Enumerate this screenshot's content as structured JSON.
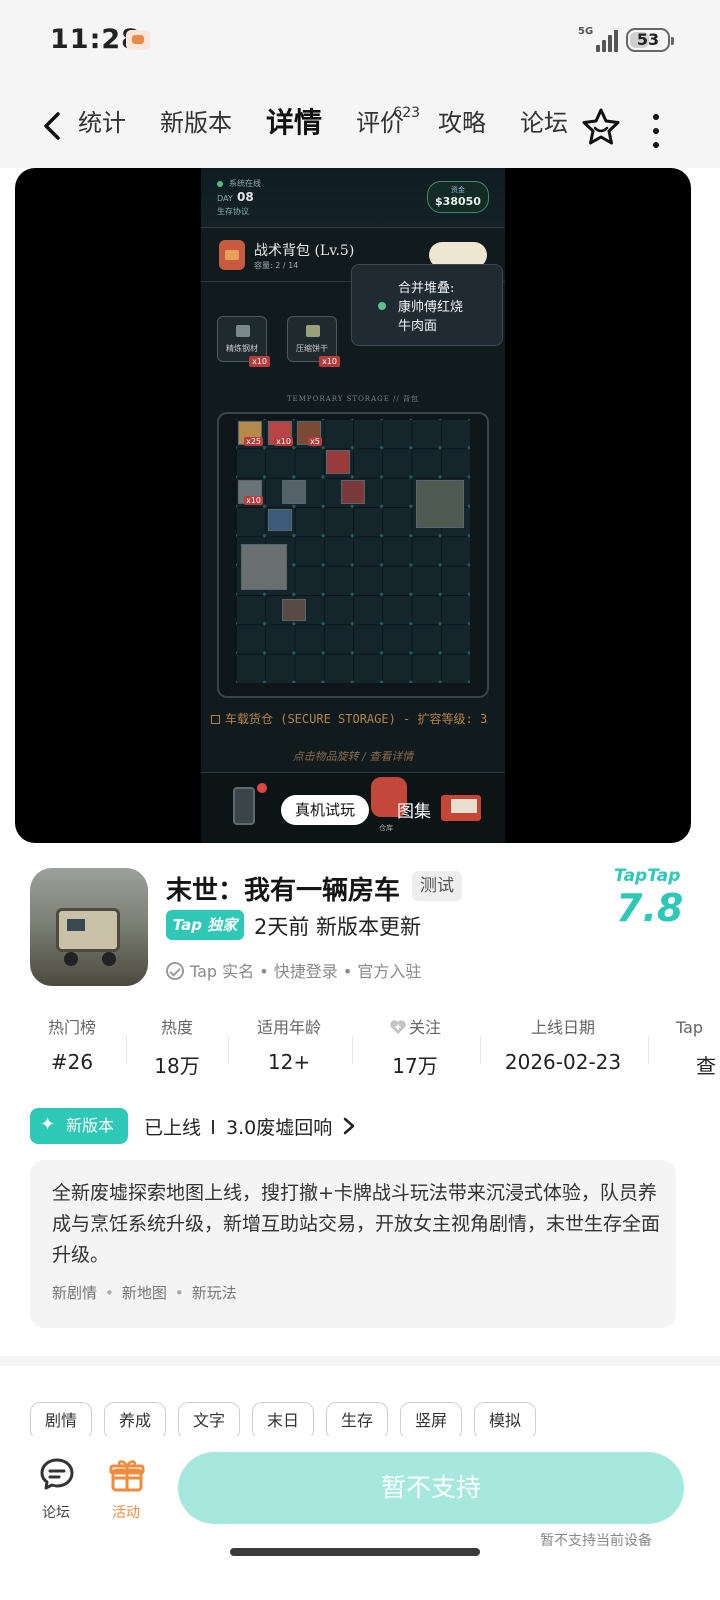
{
  "status_bar": {
    "time": "11:28",
    "network": "5G",
    "battery": "53",
    "battery_level_percent": 53
  },
  "nav": {
    "tabs": [
      {
        "label": "统计"
      },
      {
        "label": "新版本"
      },
      {
        "label": "详情",
        "active": true
      },
      {
        "label": "评价",
        "badge": "623"
      },
      {
        "label": "攻略"
      },
      {
        "label": "论坛"
      }
    ]
  },
  "media": {
    "game": {
      "system_status": "系统在线",
      "day_label": "DAY",
      "day_value": "08",
      "protocol": "生存协议",
      "money_label": "资金",
      "money_value": "$38050",
      "backpack_title": "战术背包 (Lv.5)",
      "backpack_capacity": "容量: 2 / 14",
      "tooltip": "合并堆叠:\n康帅傅红烧\n牛肉面",
      "items": [
        {
          "name": "精炼钢材",
          "qty": "x10"
        },
        {
          "name": "压缩饼干",
          "qty": "x10"
        }
      ],
      "temp_storage": "TEMPORARY STORAGE // 背包",
      "grid_qty": [
        "x25",
        "x10",
        "x5",
        "x10"
      ],
      "secure_storage": "车载货仓 (SECURE STORAGE) - 扩容等级: 3",
      "hint": "点击物品旋转 / 查看详情",
      "warehouse_label": "仓库"
    },
    "trial_button": "真机试玩",
    "gallery_label": "图集"
  },
  "app": {
    "name": "末世：我有一辆房车",
    "test_badge": "测试",
    "exclusive_badge": "Tap 独家",
    "update_text": "2天前 新版本更新",
    "verification": "Tap 实名 • 快捷登录 • 官方入驻",
    "rating_brand": "TapTap",
    "rating": "7.8"
  },
  "stats": [
    {
      "label": "热门榜",
      "value": "#26"
    },
    {
      "label": "热度",
      "value": "18万"
    },
    {
      "label": "适用年龄",
      "value": "12+"
    },
    {
      "label": "关注",
      "value": "17万"
    },
    {
      "label": "上线日期",
      "value": "2026-02-23"
    },
    {
      "label": "Tap",
      "value": "查"
    }
  ],
  "new_version": {
    "badge": "新版本",
    "status": "已上线",
    "title": "3.0废墟回响",
    "description": "全新废墟探索地图上线，搜打撤+卡牌战斗玩法带来沉浸式体验，队员养成与烹饪系统升级，新增互助站交易，开放女主视角剧情，末世生存全面升级。",
    "tags": [
      "新剧情",
      "新地图",
      "新玩法"
    ]
  },
  "tags": [
    "剧情",
    "养成",
    "文字",
    "末日",
    "生存",
    "竖屏",
    "模拟"
  ],
  "bottom_bar": {
    "forum_label": "论坛",
    "activity_label": "活动",
    "action_button": "暂不支持",
    "action_note": "暂不支持当前设备"
  },
  "colors": {
    "accent": "#2ec9b6",
    "accent_light": "#a7e8de",
    "activity": "#f08a3c"
  }
}
